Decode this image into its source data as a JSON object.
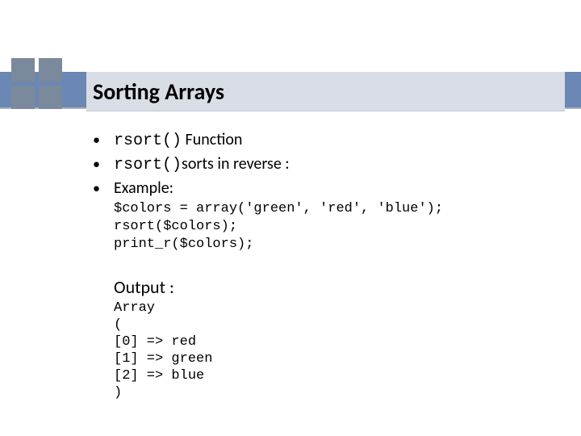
{
  "title": "Sorting Arrays",
  "bullets": {
    "b0_dot": "•",
    "b0_code": "rsort()",
    "b0_rest": " Function",
    "b1_dot": "•",
    "b1_code": "rsort()",
    "b1_rest": "sorts in reverse :",
    "b2_dot": "•",
    "b2_text": "Example:"
  },
  "code": "$colors = array('green', 'red', 'blue');\nrsort($colors);\nprint_r($colors);",
  "output_label": "Output :",
  "output": "Array\n(\n[0] => red\n[1] => green\n[2] => blue\n)"
}
